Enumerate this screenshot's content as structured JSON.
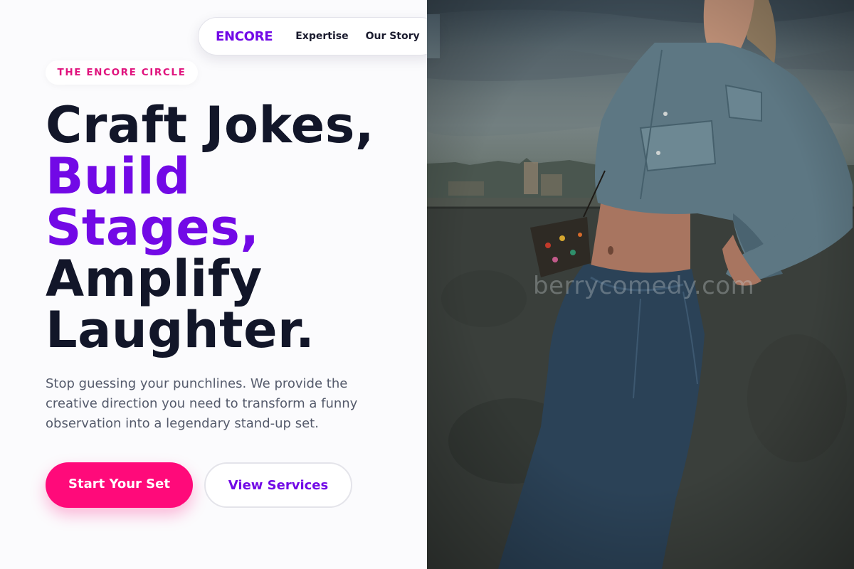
{
  "nav": {
    "brand": "ENCORE",
    "links": [
      "Expertise",
      "Our Story"
    ]
  },
  "hero": {
    "badge": "THE ENCORE CIRCLE",
    "headline_lines": [
      {
        "text": "Craft Jokes,",
        "color": "#121629"
      },
      {
        "text": "Build",
        "color": "#7209e6"
      },
      {
        "text": "Stages,",
        "color": "#7209e6"
      },
      {
        "text": "Amplify",
        "color": "#121629"
      },
      {
        "text": "Laughter.",
        "color": "#121629"
      }
    ],
    "subtext": "Stop guessing your punchlines. We provide the creative direction you need to transform a funny observation into a legendary stand-up set.",
    "primary_cta": "Start Your Set",
    "secondary_cta": "View Services"
  },
  "image": {
    "alt": "Woman in denim jacket and jeans leaning against a concrete wall at dusk",
    "watermark": "berrycomedy.com"
  },
  "colors": {
    "accent_purple": "#7209e6",
    "accent_pink": "#ff0a7a",
    "badge_pink": "#e0147e",
    "text_dark": "#121629",
    "text_muted": "#545a6b"
  }
}
